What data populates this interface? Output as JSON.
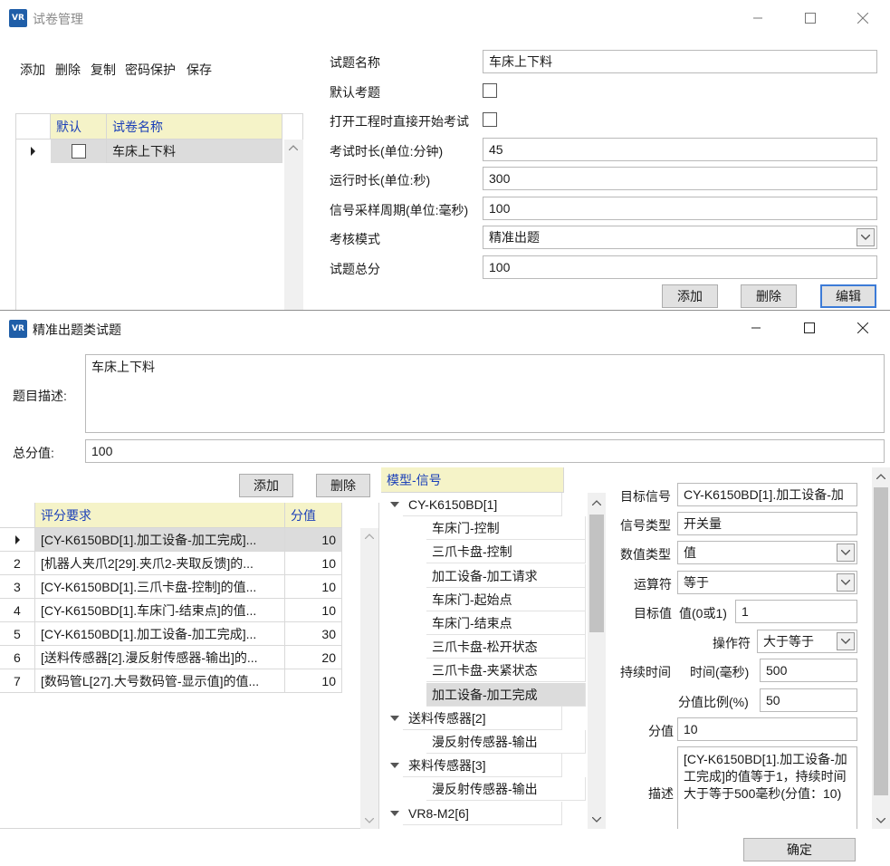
{
  "exam_window": {
    "title": "试卷管理",
    "logo_text": "VR",
    "toolbar": [
      "添加",
      "删除",
      "复制",
      "密码保护",
      "保存"
    ],
    "grid": {
      "headers": [
        "默认",
        "试卷名称"
      ],
      "rows": [
        {
          "name": "车床上下料"
        }
      ]
    },
    "form": {
      "name_label": "试题名称",
      "name_value": "车床上下料",
      "default_label": "默认考题",
      "autostart_label": "打开工程时直接开始考试",
      "duration_label": "考试时长(单位:分钟)",
      "duration_value": "45",
      "runtime_label": "运行时长(单位:秒)",
      "runtime_value": "300",
      "sampling_label": "信号采样周期(单位:毫秒)",
      "sampling_value": "100",
      "mode_label": "考核模式",
      "mode_value": "精准出题",
      "total_label": "试题总分",
      "total_value": "100"
    },
    "buttons": {
      "add": "添加",
      "delete": "删除",
      "edit": "编辑"
    }
  },
  "precise_window": {
    "title": "精准出题类试题",
    "logo_text": "VR",
    "desc_label": "题目描述:",
    "desc_value": "车床上下料",
    "total_label": "总分值:",
    "total_value": "100",
    "add_button": "添加",
    "delete_button": "删除",
    "criteria_grid": {
      "headers": [
        "评分要求",
        "分值"
      ],
      "rows": [
        {
          "idx": "1",
          "text": "[CY-K6150BD[1].加工设备-加工完成]...",
          "score": "10"
        },
        {
          "idx": "2",
          "text": "[机器人夹爪2[29].夹爪2-夹取反馈]的...",
          "score": "10"
        },
        {
          "idx": "3",
          "text": "[CY-K6150BD[1].三爪卡盘-控制]的值...",
          "score": "10"
        },
        {
          "idx": "4",
          "text": "[CY-K6150BD[1].车床门-结束点]的值...",
          "score": "10"
        },
        {
          "idx": "5",
          "text": "[CY-K6150BD[1].加工设备-加工完成]...",
          "score": "30"
        },
        {
          "idx": "6",
          "text": "[送料传感器[2].漫反射传感器-输出]的...",
          "score": "20"
        },
        {
          "idx": "7",
          "text": "[数码管L[27].大号数码管-显示值]的值...",
          "score": "10"
        }
      ]
    },
    "tree": {
      "header": "模型-信号",
      "nodes": [
        {
          "text": "CY-K6150BD[1]",
          "level": 0
        },
        {
          "text": "车床门-控制",
          "level": 1
        },
        {
          "text": "三爪卡盘-控制",
          "level": 1
        },
        {
          "text": "加工设备-加工请求",
          "level": 1
        },
        {
          "text": "车床门-起始点",
          "level": 1
        },
        {
          "text": "车床门-结束点",
          "level": 1
        },
        {
          "text": "三爪卡盘-松开状态",
          "level": 1
        },
        {
          "text": "三爪卡盘-夹紧状态",
          "level": 1
        },
        {
          "text": "加工设备-加工完成",
          "level": 1
        },
        {
          "text": "送料传感器[2]",
          "level": 0
        },
        {
          "text": "漫反射传感器-输出",
          "level": 1
        },
        {
          "text": "来料传感器[3]",
          "level": 0
        },
        {
          "text": "漫反射传感器-输出",
          "level": 1
        },
        {
          "text": "VR8-M2[6]",
          "level": 0
        }
      ]
    },
    "details": {
      "target_signal_label": "目标信号",
      "target_signal_value": "CY-K6150BD[1].加工设备-加",
      "signal_type_label": "信号类型",
      "signal_type_value": "开关量",
      "value_type_label": "数值类型",
      "value_type_value": "值",
      "operator_label": "运算符",
      "operator_value": "等于",
      "target_value_label": "目标值",
      "target_value_sub": "值(0或1)",
      "target_value_value": "1",
      "op_label": "操作符",
      "op_value": "大于等于",
      "duration_label": "持续时间",
      "duration_sub": "时间(毫秒)",
      "duration_value": "500",
      "ratio_label": "分值比例(%)",
      "ratio_value": "50",
      "score_label": "分值",
      "score_value": "10",
      "description_label": "描述",
      "description_value": "[CY-K6150BD[1].加工设备-加工完成]的值等于1，持续时间大于等于500毫秒(分值：10)"
    },
    "ok_button": "确定"
  }
}
